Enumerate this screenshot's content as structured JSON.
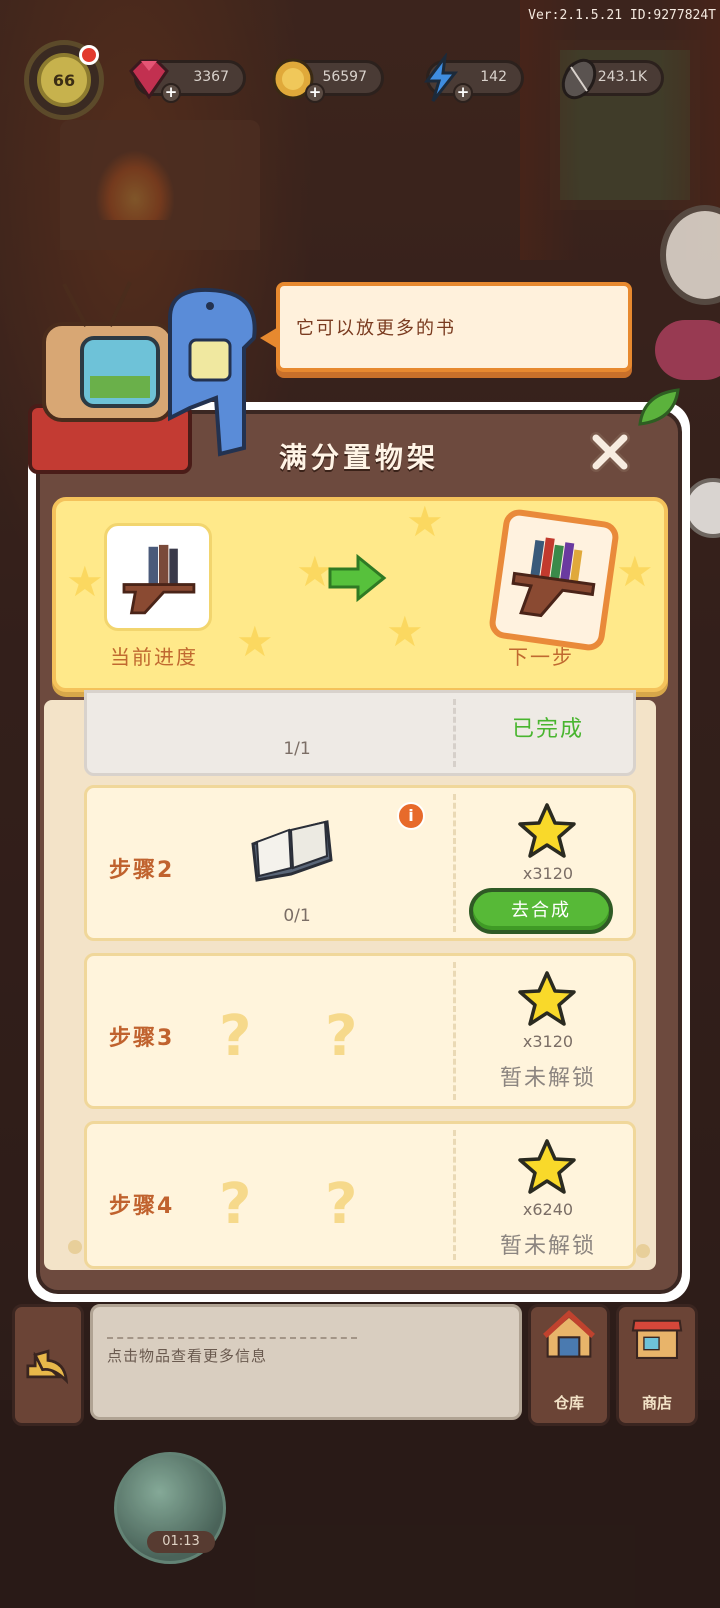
{
  "version_text": "Ver:2.1.5.21 ID:9277824T",
  "top_bar": {
    "level": "66",
    "gems": "3367",
    "coins": "56597",
    "energy": "142",
    "seeds": "243.1K"
  },
  "bubble": {
    "text": "它可以放更多的书"
  },
  "panel": {
    "title": "满分置物架",
    "current_label": "当前进度",
    "next_label": "下一步"
  },
  "steps": [
    {
      "progress": "1/1",
      "status": "已完成"
    },
    {
      "label": "步骤2",
      "progress": "0/1",
      "reward": "x3120",
      "button": "去合成"
    },
    {
      "label": "步骤3",
      "q1": "?",
      "q2": "?",
      "reward": "x3120",
      "status": "暂未解锁"
    },
    {
      "label": "步骤4",
      "q1": "?",
      "q2": "?",
      "reward": "x6240",
      "status": "暂未解锁"
    }
  ],
  "bottom": {
    "hint": "点击物品查看更多信息",
    "warehouse": "仓库",
    "shop": "商店",
    "timer": "01:13"
  },
  "colors": {
    "accent_green": "#57b937",
    "accent_orange": "#e7892f",
    "title_brown": "#6d4a3e"
  },
  "icons": [
    "gem-icon",
    "coin-icon",
    "energy-icon",
    "seed-icon",
    "close-icon",
    "star-icon",
    "book-icon",
    "arrow-right-icon",
    "back-arrow-icon",
    "warehouse-icon",
    "shop-icon",
    "info-icon"
  ]
}
